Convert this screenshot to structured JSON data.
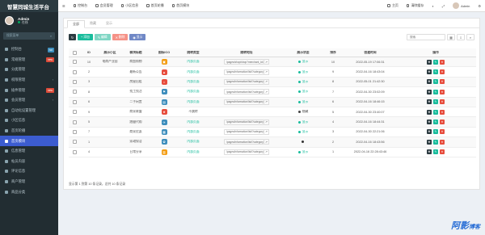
{
  "sidebar": {
    "logo": "智慧同城生活平台",
    "user": {
      "name": "Admin",
      "status": "在线"
    },
    "search_placeholder": "搜索菜单",
    "items": [
      {
        "label": "控制台",
        "badge": "hot",
        "icon": "dashboard-icon"
      },
      {
        "label": "常规管理",
        "badge": "new",
        "icon": "gear-icon"
      },
      {
        "label": "分类管理",
        "icon": "list-icon"
      },
      {
        "label": "权限管理",
        "caret": true,
        "icon": "lock-icon"
      },
      {
        "label": "插件管理",
        "badge": "new",
        "icon": "plugin-icon"
      },
      {
        "label": "会员管理",
        "caret": true,
        "icon": "user-icon"
      },
      {
        "label": "自动化设置管理",
        "icon": "cog-icon"
      },
      {
        "label": "小区信息",
        "icon": "home-icon"
      },
      {
        "label": "首页轮播",
        "icon": "image-icon"
      },
      {
        "label": "首页模块",
        "icon": "grid-icon",
        "active": true
      },
      {
        "label": "信息管理",
        "icon": "info-icon"
      },
      {
        "label": "帖员内容",
        "icon": "file-icon"
      },
      {
        "label": "评论信息",
        "icon": "comment-icon"
      },
      {
        "label": "商户管理",
        "icon": "shop-icon"
      },
      {
        "label": "商品分类",
        "icon": "tag-icon"
      }
    ]
  },
  "topbar": {
    "left": [
      "控制台",
      "会员管理",
      "小区信息",
      "首页轮播",
      "首页模块"
    ],
    "right": [
      "主页",
      "清除缓存"
    ]
  },
  "tabs": [
    "全部",
    "隐藏",
    "显示"
  ],
  "toolbar": {
    "add": "添加",
    "edit": "编辑",
    "del": "删除",
    "display": "显示",
    "search_placeholder": "搜索"
  },
  "table": {
    "headers": [
      "",
      "ID",
      "展示小区",
      "模块标题",
      "图标ICO",
      "跳转类型",
      "跳转地址",
      "展示状态",
      "排序",
      "创建时间",
      "操作"
    ],
    "rows": [
      {
        "id": "10",
        "area": "电商产业园",
        "title": "商超购物",
        "icon_color": "#f39c12",
        "type": "内部页面",
        "url": "/pages/shop/shop?merchant_id=1",
        "show": "显示",
        "show_color": "#18bc9c",
        "sort": "10",
        "time": "2022-05-19 17:06:31"
      },
      {
        "id": "2",
        "area": "",
        "title": "最新公告",
        "icon_color": "#e74c3c",
        "type": "内部页面",
        "url": "/pages/information/list/?category_id",
        "show": "显示",
        "show_color": "#18bc9c",
        "sort": "9",
        "time": "2022-04-16 18:43:04"
      },
      {
        "id": "3",
        "area": "",
        "title": "房屋出租",
        "icon_color": "#e74c3c",
        "type": "内部页面",
        "url": "/pages/information/list/?category_id",
        "show": "显示",
        "show_color": "#18bc9c",
        "sort": "8",
        "time": "2022-05-01 21:42:30"
      },
      {
        "id": "8",
        "area": "",
        "title": "找工找活",
        "icon_color": "#3c8dbc",
        "type": "内部页面",
        "url": "/pages/information/list/?category_id",
        "show": "显示",
        "show_color": "#18bc9c",
        "sort": "7",
        "time": "2022-04-30 23:02:09"
      },
      {
        "id": "6",
        "area": "",
        "title": "二手闲置",
        "icon_color": "#3c8dbc",
        "type": "内部页面",
        "url": "/pages/information/list/?category_id",
        "show": "显示",
        "show_color": "#18bc9c",
        "sort": "6",
        "time": "2022-04-16 18:46:15"
      },
      {
        "id": "9",
        "area": "",
        "title": "商家联盟",
        "icon_color": "#e74c3c",
        "type": "不跳转",
        "url": "",
        "show": "隐藏",
        "show_color": "#444444",
        "sort": "5",
        "time": "2022-04-30 23:40:07"
      },
      {
        "id": "5",
        "area": "",
        "title": "跑腿代购",
        "icon_color": "#3c8dbc",
        "type": "内部页面",
        "url": "/pages/information/list/?category_id",
        "show": "显示",
        "show_color": "#18bc9c",
        "sort": "4",
        "time": "2022-04-16 18:44:31"
      },
      {
        "id": "7",
        "area": "",
        "title": "商家优惠",
        "icon_color": "#3c8dbc",
        "type": "内部页面",
        "url": "/pages/information/list/?category_id",
        "show": "显示",
        "show_color": "#18bc9c",
        "sort": "3",
        "time": "2022-04-30 22:21:06"
      },
      {
        "id": "1",
        "area": "",
        "title": "家政保洁",
        "icon_color": "#3c8dbc",
        "type": "内部页面",
        "url": "/pages/information/list/?category_id",
        "show": "",
        "show_color": "#333333",
        "sort": "2",
        "time": "2022-04-16 18:43:56"
      },
      {
        "id": "4",
        "area": "",
        "title": "日常分享",
        "icon_color": "#f39c12",
        "type": "内部页面",
        "url": "/pages/information/list/?category_id",
        "show": "显示",
        "show_color": "#18bc9c",
        "sort": "1",
        "time": "2022-04-16 22:28:43:46"
      }
    ]
  },
  "footer": "显示第 1 到第 10 条记录，总共 10 条记录",
  "watermark": {
    "main": "阿影",
    "sub": "博客"
  }
}
